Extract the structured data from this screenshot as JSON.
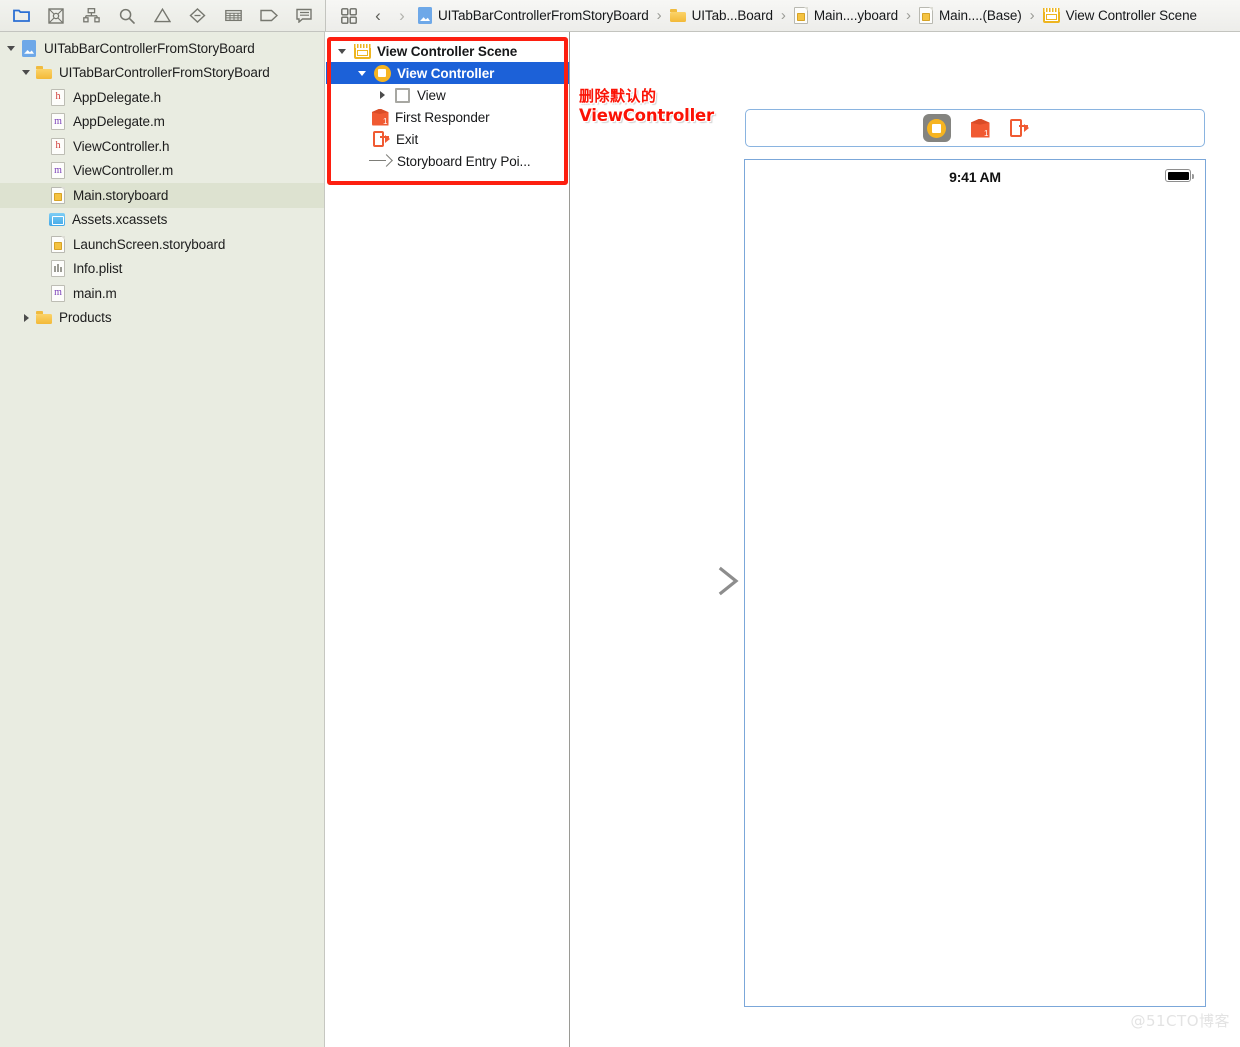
{
  "navigator_toolbar": {
    "icons": [
      {
        "name": "folder-icon",
        "glyph": "project-navigator",
        "active": true
      },
      {
        "name": "source-control-icon",
        "glyph": "source-control"
      },
      {
        "name": "symbol-navigator-icon",
        "glyph": "symbol"
      },
      {
        "name": "search-icon",
        "glyph": "magnifier"
      },
      {
        "name": "issue-navigator-icon",
        "glyph": "warning-triangle"
      },
      {
        "name": "test-navigator-icon",
        "glyph": "diamond"
      },
      {
        "name": "debug-navigator-icon",
        "glyph": "grid-lines"
      },
      {
        "name": "breakpoint-navigator-icon",
        "glyph": "tag"
      },
      {
        "name": "report-navigator-icon",
        "glyph": "speech-bubble"
      }
    ]
  },
  "breadcrumb": {
    "tool_icon": "related-items-icon",
    "back_label": "‹",
    "forward_label": "›",
    "items": [
      {
        "label": "UITabBarControllerFromStoryBoard",
        "icon": "project-icon"
      },
      {
        "label": "UITab...Board",
        "icon": "folder-icon"
      },
      {
        "label": "Main....yboard",
        "icon": "storyboard-icon"
      },
      {
        "label": "Main....(Base)",
        "icon": "storyboard-icon"
      },
      {
        "label": "View Controller Scene",
        "icon": "scene-icon"
      }
    ],
    "separator": "›"
  },
  "project_navigator": {
    "rows": [
      {
        "label": "UITabBarControllerFromStoryBoard",
        "icon": "project-icon",
        "indent": 0,
        "twisty": "open",
        "selected": false
      },
      {
        "label": "UITabBarControllerFromStoryBoard",
        "icon": "folder-icon",
        "indent": 1,
        "twisty": "open",
        "selected": false
      },
      {
        "label": "AppDelegate.h",
        "icon": "header-file-icon",
        "indent": 2,
        "twisty": "none",
        "selected": false
      },
      {
        "label": "AppDelegate.m",
        "icon": "impl-file-icon",
        "indent": 2,
        "twisty": "none",
        "selected": false
      },
      {
        "label": "ViewController.h",
        "icon": "header-file-icon",
        "indent": 2,
        "twisty": "none",
        "selected": false
      },
      {
        "label": "ViewController.m",
        "icon": "impl-file-icon",
        "indent": 2,
        "twisty": "none",
        "selected": false
      },
      {
        "label": "Main.storyboard",
        "icon": "storyboard-icon",
        "indent": 2,
        "twisty": "none",
        "selected": true
      },
      {
        "label": "Assets.xcassets",
        "icon": "assets-icon",
        "indent": 2,
        "twisty": "none",
        "selected": false
      },
      {
        "label": "LaunchScreen.storyboard",
        "icon": "storyboard-icon",
        "indent": 2,
        "twisty": "none",
        "selected": false
      },
      {
        "label": "Info.plist",
        "icon": "plist-icon",
        "indent": 2,
        "twisty": "none",
        "selected": false
      },
      {
        "label": "main.m",
        "icon": "impl-file-icon",
        "indent": 2,
        "twisty": "none",
        "selected": false
      },
      {
        "label": "Products",
        "icon": "folder-icon",
        "indent": 1,
        "twisty": "closed",
        "selected": false
      }
    ]
  },
  "outline": {
    "rows": [
      {
        "label": "View Controller Scene",
        "icon": "scene-icon",
        "indent": 0,
        "twisty": "open",
        "selected": false,
        "bold": true
      },
      {
        "label": "View Controller",
        "icon": "view-controller-icon",
        "indent": 1,
        "twisty": "open",
        "selected": true,
        "bold": true
      },
      {
        "label": "View",
        "icon": "view-icon",
        "indent": 2,
        "twisty": "closed",
        "selected": false,
        "bold": false
      },
      {
        "label": "First Responder",
        "icon": "first-responder-icon",
        "indent": 2,
        "twisty": "none",
        "selected": false,
        "bold": false
      },
      {
        "label": "Exit",
        "icon": "exit-icon",
        "indent": 2,
        "twisty": "none",
        "selected": false,
        "bold": false
      },
      {
        "label": "Storyboard Entry Poi...",
        "icon": "entry-point-icon",
        "indent": 2,
        "twisty": "none",
        "selected": false,
        "bold": false
      }
    ],
    "highlight_color": "#1c61d8"
  },
  "annotation": {
    "line1": "删除默认的",
    "line2": "ViewController",
    "color": "#fb1205"
  },
  "red_highlight": {
    "color": "#fd1f10",
    "target": "view-controller-scene-outline"
  },
  "canvas": {
    "scene_toolbar": {
      "items": [
        {
          "name": "view-controller-placeholder-icon",
          "selected": true
        },
        {
          "name": "first-responder-icon",
          "selected": false
        },
        {
          "name": "exit-icon",
          "selected": false
        }
      ]
    },
    "device": {
      "status_time": "9:41 AM",
      "battery_icon": "battery-full-icon",
      "border_color": "#7ba7d9"
    },
    "entry_arrow": {
      "name": "storyboard-entry-point-arrow"
    }
  },
  "watermark": {
    "text": "@51CTO博客"
  }
}
